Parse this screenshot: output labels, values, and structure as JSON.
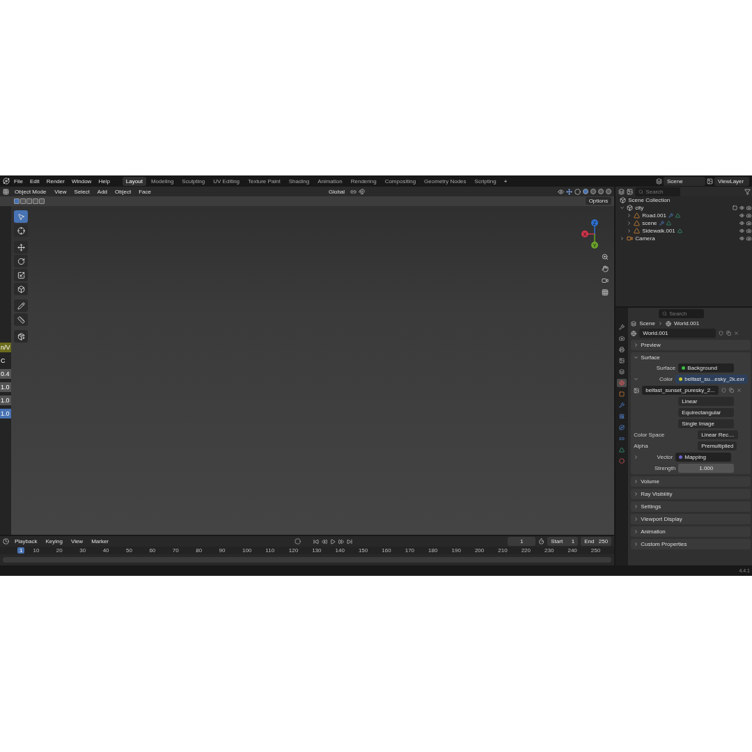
{
  "menu": [
    "File",
    "Edit",
    "Render",
    "Window",
    "Help"
  ],
  "workspaces": [
    {
      "label": "Layout",
      "selected": true
    },
    {
      "label": "Modeling",
      "selected": false
    },
    {
      "label": "Sculpting",
      "selected": false
    },
    {
      "label": "UV Editing",
      "selected": false
    },
    {
      "label": "Texture Paint",
      "selected": false
    },
    {
      "label": "Shading",
      "selected": false
    },
    {
      "label": "Animation",
      "selected": false
    },
    {
      "label": "Rendering",
      "selected": false
    },
    {
      "label": "Compositing",
      "selected": false
    },
    {
      "label": "Geometry Nodes",
      "selected": false
    },
    {
      "label": "Scripting",
      "selected": false
    }
  ],
  "add_workspace": "+",
  "scene": "Scene",
  "view_layer": "ViewLayer",
  "viewport": {
    "mode": "Object Mode",
    "menu": [
      "View",
      "Select",
      "Add",
      "Object",
      "Face"
    ],
    "orientation": "Global",
    "options": "Options",
    "select_modes": [
      {
        "selected": true
      },
      {
        "selected": false
      },
      {
        "selected": false
      },
      {
        "selected": false
      },
      {
        "selected": false
      }
    ],
    "tools": [
      {
        "kind": "select",
        "selected": true
      },
      {
        "kind": "cursor",
        "selected": false
      },
      {
        "kind": "move",
        "selected": false
      },
      {
        "kind": "rotate",
        "selected": false
      },
      {
        "kind": "scale",
        "selected": false
      },
      {
        "kind": "transform",
        "selected": false
      },
      {
        "kind": "annotate",
        "selected": false
      },
      {
        "kind": "measure",
        "selected": false
      },
      {
        "kind": "add",
        "selected": false
      }
    ],
    "shading": [
      {
        "selected": true
      },
      {
        "selected": false
      },
      {
        "selected": false
      },
      {
        "selected": false
      }
    ],
    "sidebar_texts": [
      {
        "text": "n/V",
        "kind": "header"
      },
      {
        "text": "C",
        "kind": "label"
      },
      {
        "text": "0.4",
        "kind": "value"
      },
      {
        "text": "1.0",
        "kind": "value"
      },
      {
        "text": "1.0",
        "kind": "value"
      },
      {
        "text": "1.0",
        "kind": "active"
      }
    ],
    "axes": [
      {
        "label": "Z",
        "color": "#2f6fd0"
      },
      {
        "label": "X",
        "color": "#d0344a"
      },
      {
        "label": "Y",
        "color": "#6ba32a"
      }
    ]
  },
  "outliner": {
    "search_placeholder": "Search",
    "root": "Scene Collection",
    "tree": [
      {
        "name": "city",
        "kind": "collection",
        "expanded": true,
        "children": [
          {
            "name": "Road.001",
            "kind": "mesh",
            "expanded": false,
            "modifier": true
          },
          {
            "name": "scene",
            "kind": "mesh",
            "expanded": false,
            "modifier": true
          },
          {
            "name": "Sidewalk.001",
            "kind": "mesh",
            "expanded": false,
            "modifier": false
          }
        ]
      },
      {
        "name": "Camera",
        "kind": "camera",
        "expanded": false,
        "modifier": false
      }
    ]
  },
  "properties": {
    "search_placeholder": "Search",
    "tabs": [
      {
        "kind": "tool",
        "selected": false
      },
      {
        "kind": "render",
        "selected": false
      },
      {
        "kind": "output",
        "selected": false
      },
      {
        "kind": "view",
        "selected": false
      },
      {
        "kind": "scene",
        "selected": false
      },
      {
        "kind": "world",
        "selected": true
      },
      {
        "kind": "object",
        "selected": false
      },
      {
        "kind": "modifier",
        "selected": false
      },
      {
        "kind": "particles",
        "selected": false
      },
      {
        "kind": "physics",
        "selected": false
      },
      {
        "kind": "constraints",
        "selected": false
      },
      {
        "kind": "data",
        "selected": false
      },
      {
        "kind": "material",
        "selected": false
      }
    ],
    "breadcrumb": [
      "Scene",
      "World.001"
    ],
    "world": "World.001",
    "panels": [
      {
        "title": "Preview",
        "kind": "plain",
        "expanded": false
      },
      {
        "title": "Surface",
        "kind": "surface",
        "expanded": true
      },
      {
        "title": "Volume",
        "kind": "plain",
        "expanded": false
      },
      {
        "title": "Ray Visibility",
        "kind": "plain",
        "expanded": false
      },
      {
        "title": "Settings",
        "kind": "plain",
        "expanded": false
      },
      {
        "title": "Viewport Display",
        "kind": "plain",
        "expanded": false
      },
      {
        "title": "Animation",
        "kind": "plain",
        "expanded": false
      },
      {
        "title": "Custom Properties",
        "kind": "plain",
        "expanded": false
      }
    ],
    "surface": {
      "shader": {
        "label": "Surface",
        "value": "Background",
        "color": "#3dbb46"
      },
      "texture": {
        "label": "Color",
        "value": "belfast_su...esky_2k.exr",
        "color": "#c7c729"
      },
      "image": "belfast_sunset_puresky_2...",
      "dropdowns": [
        "Linear",
        "Equirectangular",
        "Single Image"
      ],
      "rows": [
        {
          "label": "Color Space",
          "value": "Linear Rec...."
        },
        {
          "label": "Alpha",
          "value": "Premultiplied"
        }
      ],
      "vector": {
        "label": "Vector",
        "value": "Mapping",
        "color": "#6a63c9"
      },
      "strength_label": "Strength",
      "strength": "1.000"
    }
  },
  "timeline": {
    "menu": [
      "Playback",
      "Keying",
      "View",
      "Marker"
    ],
    "current": "1",
    "start_label": "Start",
    "start": "1",
    "end_label": "End",
    "end": "250",
    "playhead": "1",
    "ticks": [
      "10",
      "20",
      "30",
      "40",
      "50",
      "60",
      "70",
      "80",
      "90",
      "100",
      "110",
      "120",
      "130",
      "140",
      "150",
      "160",
      "170",
      "180",
      "190",
      "200",
      "210",
      "220",
      "230",
      "240",
      "250"
    ]
  },
  "version": "4.4.1"
}
